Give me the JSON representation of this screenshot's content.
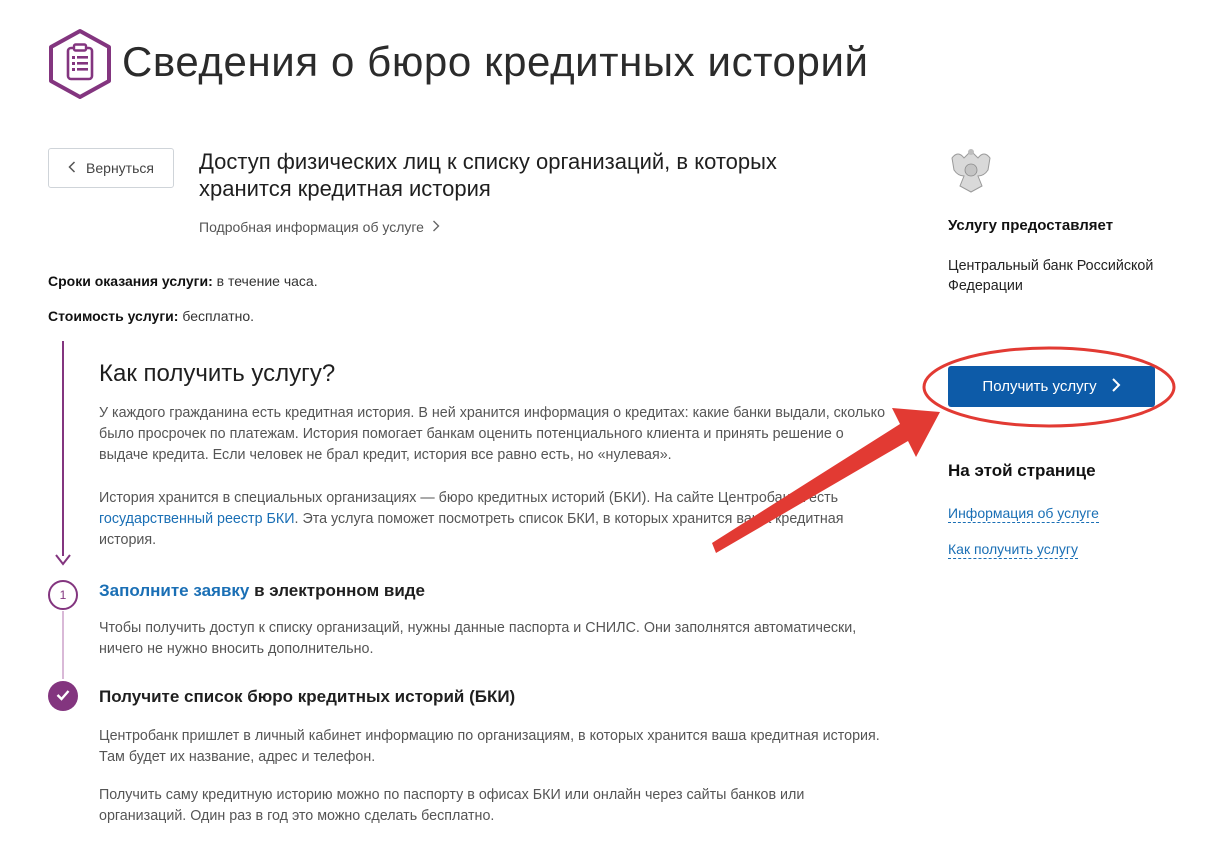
{
  "header": {
    "title": "Сведения о бюро кредитных историй",
    "icon": "clipboard-icon",
    "accent_color": "#83357f"
  },
  "nav": {
    "back_label": "Вернуться",
    "details_link": "Подробная информация об услуге"
  },
  "service": {
    "title": "Доступ физических лиц к списку организаций, в которых хранится кредитная история"
  },
  "meta": {
    "terms_label": "Сроки оказания услуги:",
    "terms_value": "в течение часа.",
    "cost_label": "Стоимость услуги:",
    "cost_value": "бесплатно."
  },
  "how": {
    "title": "Как получить услугу?",
    "para1": "У каждого гражданина есть кредитная история. В ней хранится информация о кредитах: какие банки выдали, сколько было просрочек по платежам. История помогает банкам оценить потенциального клиента и принять решение о выдаче кредита. Если человек не брал кредит, история все равно есть, но «нулевая».",
    "para2_before": "История хранится в специальных организациях — бюро кредитных историй (БКИ). На сайте Центробанка есть",
    "para2_link": "государственный реестр БКИ",
    "para2_after": ". Эта услуга поможет посмотреть список БКИ, в которых хранится ваша кредитная история."
  },
  "steps": [
    {
      "number": "1",
      "title_link": "Заполните заявку",
      "title_rest": " в электронном виде",
      "text": "Чтобы получить доступ к списку организаций, нужны данные паспорта и СНИЛС. Они заполнятся автоматически, ничего не нужно вносить дополнительно."
    },
    {
      "icon": "check-icon",
      "title": "Получите список бюро кредитных историй (БКИ)",
      "text1": "Центробанк пришлет в личный кабинет информацию по организациям, в которых хранится ваша кредитная история. Там будет их название, адрес и телефон.",
      "text2": "Получить саму кредитную историю можно по паспорту в офисах БКИ или онлайн через сайты банков или организаций. Один раз в год это можно сделать бесплатно."
    }
  ],
  "sidebar": {
    "emblem_icon": "coat-of-arms-icon",
    "provider_heading": "Услугу предоставляет",
    "provider_name": "Центральный банк Российской Федерации",
    "get_service_label": "Получить услугу",
    "button_color": "#0d5ba8",
    "on_page_heading": "На этой странице",
    "on_page_links": [
      "Информация об услуге",
      "Как получить услугу"
    ]
  },
  "annotation": {
    "color": "#e23a33"
  }
}
